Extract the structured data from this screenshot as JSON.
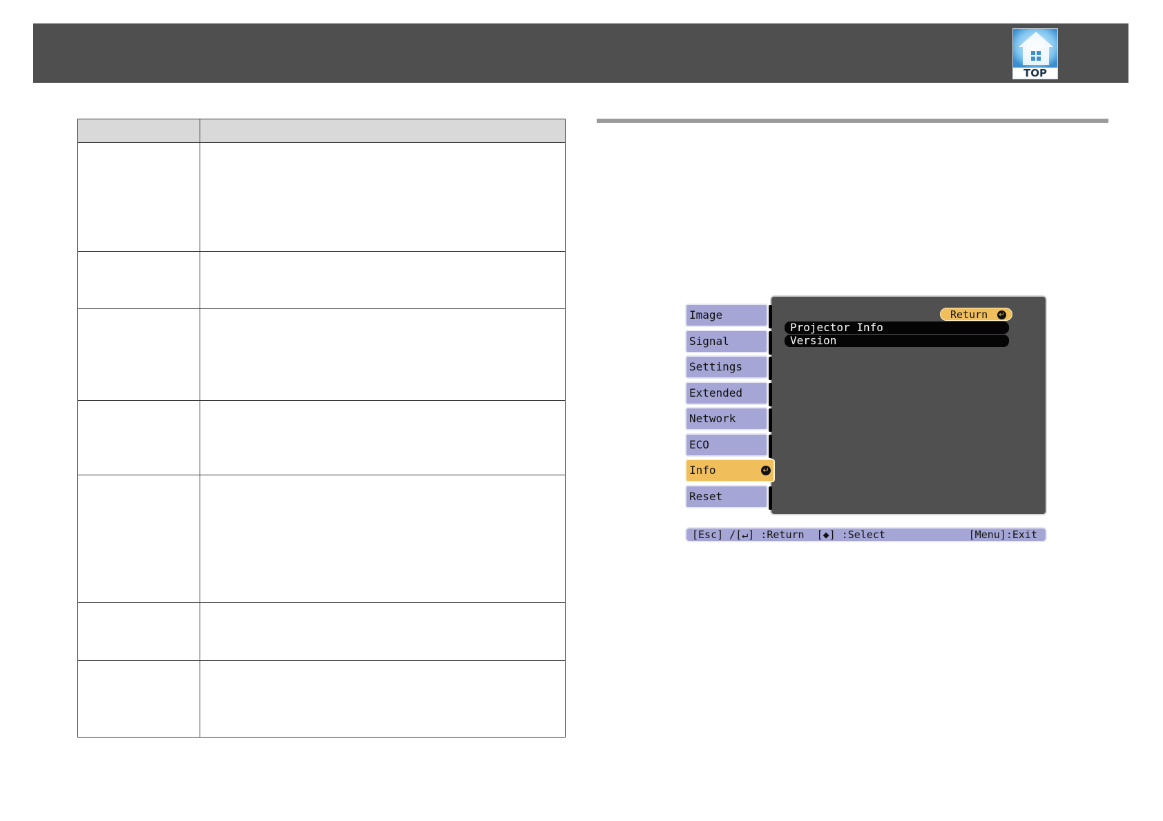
{
  "header": {
    "top_label": "TOP",
    "top_icon": "home-icon"
  },
  "table": {
    "rows": 7
  },
  "projector_menu": {
    "sidebar": [
      {
        "label": "Image",
        "selected": false
      },
      {
        "label": "Signal",
        "selected": false
      },
      {
        "label": "Settings",
        "selected": false
      },
      {
        "label": "Extended",
        "selected": false
      },
      {
        "label": "Network",
        "selected": false
      },
      {
        "label": "ECO",
        "selected": false
      },
      {
        "label": "Info",
        "selected": true
      },
      {
        "label": "Reset",
        "selected": false
      }
    ],
    "return_label": "Return",
    "submenu": [
      {
        "label": "Projector Info"
      },
      {
        "label": "Version"
      }
    ],
    "status_left": "[Esc] /[↵] :Return  [◆] :Select",
    "status_right": "[Menu]:Exit"
  },
  "colors": {
    "header": "#4f4f4f",
    "menu_item": "#a6a6d6",
    "menu_active": "#f0bf5c",
    "panel": "#505050"
  }
}
